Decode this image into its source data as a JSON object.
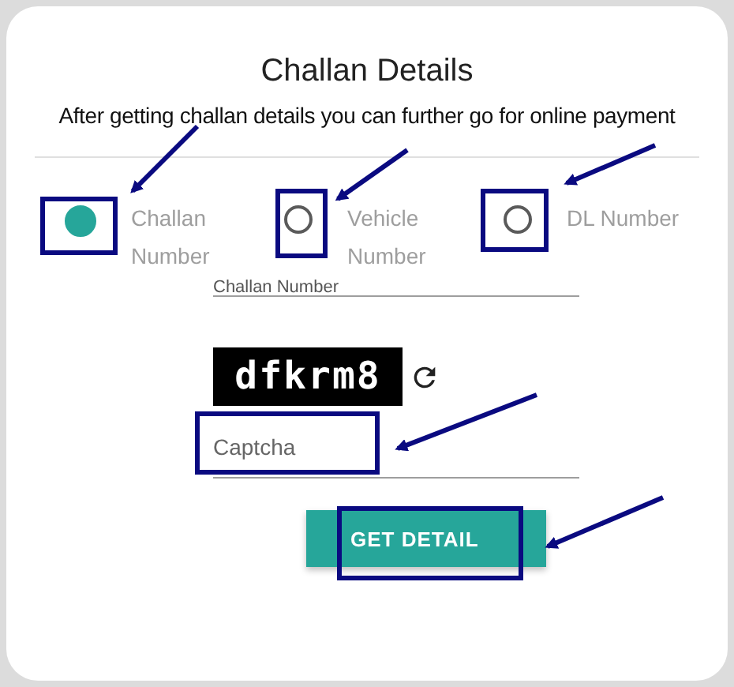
{
  "title": "Challan Details",
  "subtitle": "After getting challan details you can further go for online payment",
  "search_options": [
    {
      "label": "Challan Number",
      "selected": true
    },
    {
      "label": "Vehicle Number",
      "selected": false
    },
    {
      "label": "DL Number",
      "selected": false
    }
  ],
  "number_field": {
    "label": "Challan Number"
  },
  "captcha_image": {
    "text": "dfkrm8"
  },
  "captcha_field": {
    "placeholder": "Captcha"
  },
  "button": "GET DETAIL"
}
